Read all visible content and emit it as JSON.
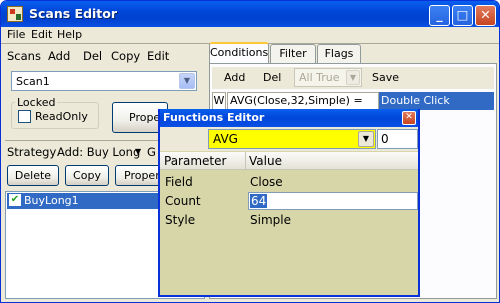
{
  "window": {
    "title": "Scans Editor"
  },
  "titlebar": {
    "min_glyph": "_",
    "max_glyph": "□",
    "close_glyph": "✕"
  },
  "menu": {
    "file": "File",
    "edit": "Edit",
    "help": "Help"
  },
  "scans": {
    "label": "Scans",
    "add": "Add",
    "del": "Del",
    "copy": "Copy",
    "edit": "Edit",
    "selected": "Scan1",
    "locked_label": "Locked",
    "readonly_label": "ReadOnly",
    "properties_partial": "Prope"
  },
  "strategy": {
    "label": "Strategy",
    "add_label": "Add: Buy Long",
    "extra_partial": "G",
    "delete": "Delete",
    "copy": "Copy",
    "properties_partial": "Proper",
    "items": [
      {
        "name": "BuyLong1",
        "checked": true
      }
    ]
  },
  "conditions": {
    "tabs": [
      {
        "label": "Conditions",
        "active": true
      },
      {
        "label": "Filter",
        "active": false
      },
      {
        "label": "Flags",
        "active": false
      }
    ],
    "add": "Add",
    "del": "Del",
    "filter_value": "All True",
    "save": "Save",
    "row": {
      "col1": "W",
      "expression": "AVG(Close,32,Simple) =",
      "action": "Double Click"
    }
  },
  "functions_editor": {
    "title": "Functions Editor",
    "function": "AVG",
    "offset": "0",
    "headers": {
      "parameter": "Parameter",
      "value": "Value"
    },
    "rows": [
      {
        "parameter": "Field",
        "value": "Close"
      },
      {
        "parameter": "Count",
        "value": "64",
        "editing": true
      },
      {
        "parameter": "Style",
        "value": "Simple"
      }
    ]
  },
  "colors": {
    "accent": "#0A5FEF",
    "selection": "#316AC5",
    "function_highlight": "#FFFF00",
    "dialog_bg": "#D7D6A9"
  }
}
